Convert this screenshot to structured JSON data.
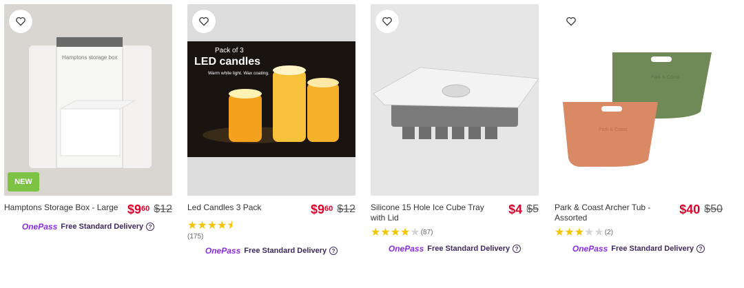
{
  "colors": {
    "accent_price": "#e0002a",
    "onepass": "#8a2be2",
    "badge_new": "#7cc243"
  },
  "products": [
    {
      "title": "Hamptons Storage Box - Large",
      "price_dollars": "$9",
      "price_cents": "60",
      "was_price": "$12",
      "badge": "NEW",
      "box_label": "Hamptons storage box",
      "delivery": {
        "brand": "OnePass",
        "label": "Free Standard Delivery"
      }
    },
    {
      "title": "Led Candles 3 Pack",
      "price_dollars": "$9",
      "price_cents": "60",
      "was_price": "$12",
      "rating": 4.5,
      "review_count": "(175)",
      "box_label_small": "Pack of 3",
      "box_label_big": "LED candles",
      "box_label_note": "Warm white light. Wax coating.",
      "delivery": {
        "brand": "OnePass",
        "label": "Free Standard Delivery"
      }
    },
    {
      "title": "Silicone 15 Hole Ice Cube Tray with Lid",
      "price_dollars": "$4",
      "was_price": "$5",
      "rating": 4,
      "review_count": "(87)",
      "delivery": {
        "brand": "OnePass",
        "label": "Free Standard Delivery"
      }
    },
    {
      "title": "Park & Coast Archer Tub - Assorted",
      "price_dollars": "$40",
      "was_price": "$50",
      "rating": 3,
      "review_count": "(2)",
      "tub_label": "Park & Coast",
      "delivery": {
        "brand": "OnePass",
        "label": "Free Standard Delivery"
      }
    }
  ]
}
